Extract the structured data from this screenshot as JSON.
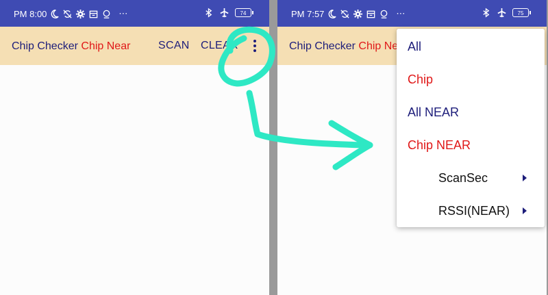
{
  "left_screen": {
    "status": {
      "time": "PM 8:00",
      "more": "⋯",
      "battery": "74"
    },
    "app_bar": {
      "title_part1": "Chip Checker",
      "title_part2": "Chip Near",
      "scan_label": "SCAN",
      "clear_label": "CLEAR"
    }
  },
  "right_screen": {
    "status": {
      "time": "PM 7:57",
      "more": "⋯",
      "battery": "75"
    },
    "app_bar": {
      "title_part1": "Chip Checker",
      "title_part2": "Chip Ne"
    },
    "menu": {
      "items": [
        {
          "label": "All",
          "color": "#1d1d7a"
        },
        {
          "label": "Chip",
          "color": "#e01818"
        },
        {
          "label": "All NEAR",
          "color": "#1d1d7a"
        },
        {
          "label": "Chip NEAR",
          "color": "#e01818"
        },
        {
          "label": "ScanSec",
          "submenu": true
        },
        {
          "label": "RSSI(NEAR)",
          "submenu": true
        }
      ]
    }
  },
  "colors": {
    "status_bar": "#3f4bb3",
    "app_bar": "#f5dfb4",
    "title_primary": "#1d1d7a",
    "title_accent": "#e01818",
    "annotation": "#2ee8c4"
  },
  "icons": [
    "moon-icon",
    "sync-off-icon",
    "gear-icon",
    "calendar-icon",
    "location-icon",
    "bluetooth-icon",
    "airplane-icon",
    "battery-icon",
    "overflow-menu-icon",
    "submenu-arrow-icon"
  ]
}
